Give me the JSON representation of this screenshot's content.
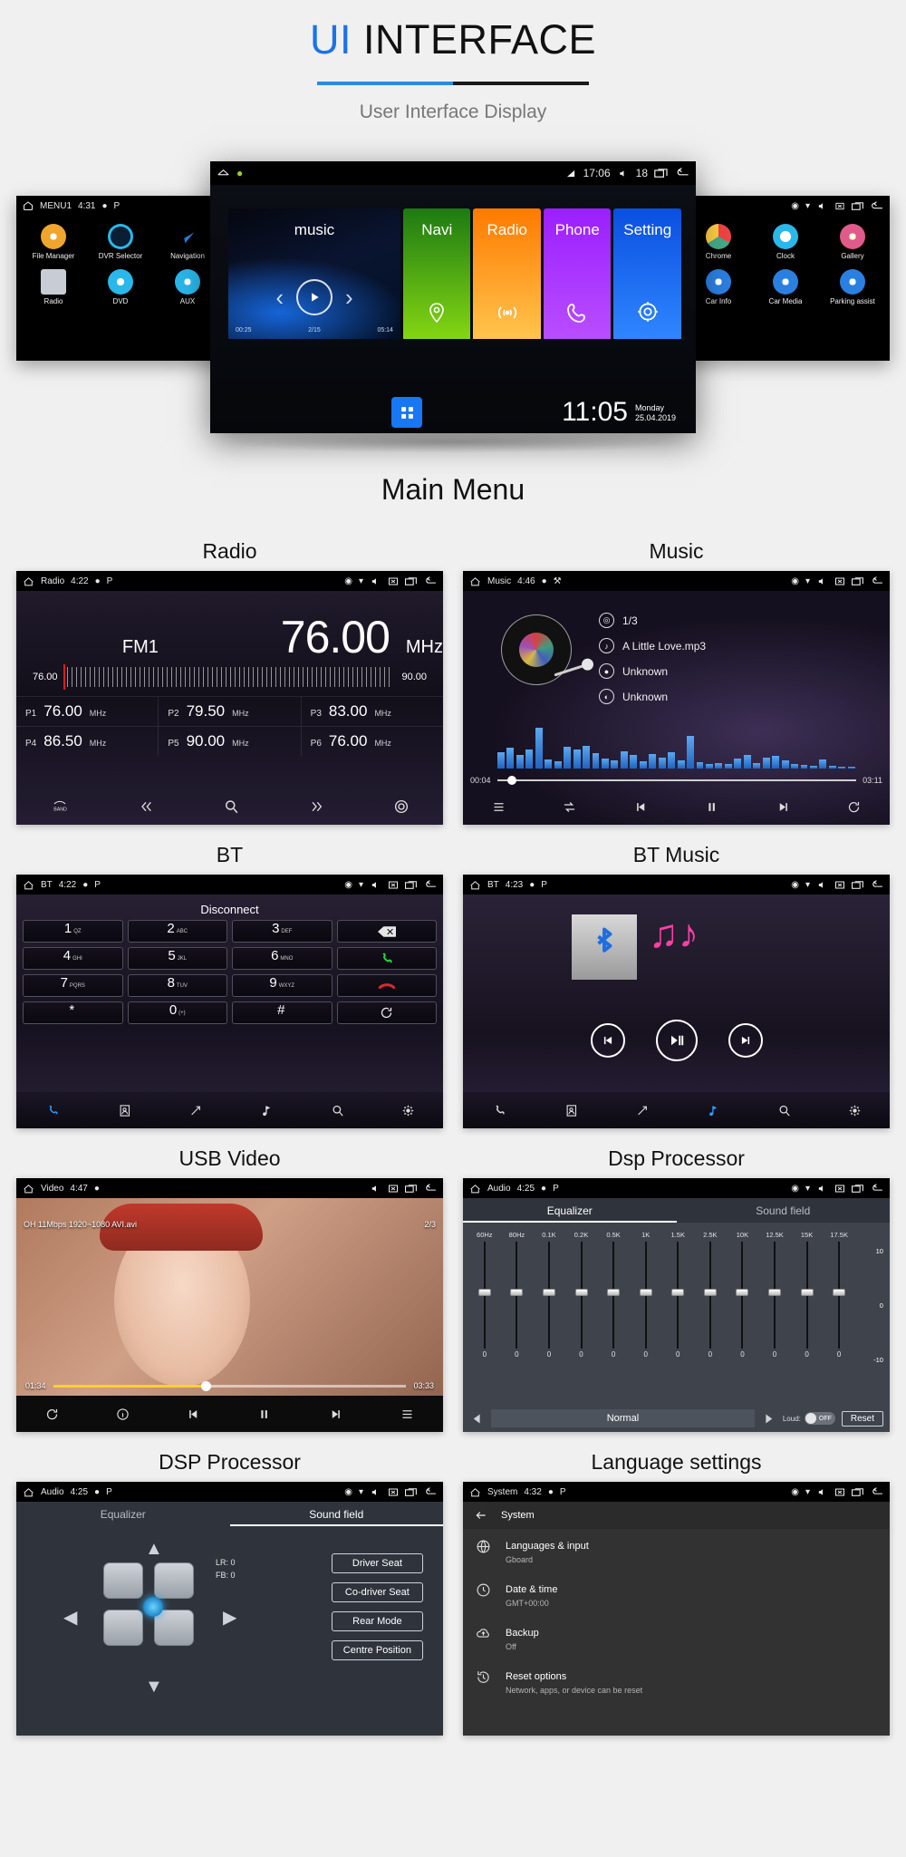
{
  "header": {
    "title_accent": "UI",
    "title_rest": " INTERFACE",
    "subtitle": "User Interface Display",
    "accent_color": "#1a73e8"
  },
  "hero": {
    "left_device": {
      "status": {
        "title": "MENU1",
        "time": "4:31"
      },
      "apps": [
        {
          "label": "File Manager",
          "icon": "disc-icon",
          "color": "#f0a52e"
        },
        {
          "label": "DVR Selector",
          "icon": "camera-lens-icon",
          "color": "#2ab7ea"
        },
        {
          "label": "Navigation",
          "icon": "navigation-arrow-icon",
          "color": "#2b7fe0"
        },
        {
          "label": "Radio",
          "icon": "radio-icon",
          "color": "#c8ccd4"
        },
        {
          "label": "DVD",
          "icon": "dvd-icon",
          "color": "#2ab7ea"
        },
        {
          "label": "AUX",
          "icon": "aux-icon",
          "color": "#2ab7ea"
        }
      ]
    },
    "center_device": {
      "status": {
        "time": "17:06",
        "volume": "18"
      },
      "tiles": [
        {
          "label": "music",
          "key": "music"
        },
        {
          "label": "Navi",
          "key": "navi"
        },
        {
          "label": "Radio",
          "key": "radio"
        },
        {
          "label": "Phone",
          "key": "phone"
        },
        {
          "label": "Setting",
          "key": "setting"
        }
      ],
      "music_time_elapsed": "00:25",
      "music_track": "2/15",
      "music_time_total": "05:14",
      "clock": "11:05",
      "day": "Monday",
      "date": "25.04.2019"
    },
    "right_device": {
      "apps": [
        {
          "label": "Chrome",
          "icon": "chrome-icon",
          "color": "#e44"
        },
        {
          "label": "Clock",
          "icon": "clock-icon",
          "color": "#2ab7ea"
        },
        {
          "label": "Gallery",
          "icon": "gallery-icon",
          "color": "#e05a8a"
        },
        {
          "label": "Car Info",
          "icon": "car-info-icon",
          "color": "#2b7fe0"
        },
        {
          "label": "Car Media",
          "icon": "car-media-icon",
          "color": "#2b7fe0"
        },
        {
          "label": "Parking assist",
          "icon": "parking-assist-icon",
          "color": "#2b7fe0"
        }
      ]
    }
  },
  "main_menu_title": "Main Menu",
  "panels": {
    "radio": {
      "caption": "Radio",
      "status": {
        "title": "Radio",
        "time": "4:22"
      },
      "band": "FM1",
      "frequency": "76.00",
      "unit": "MHz",
      "scale_min": "76.00",
      "scale_max": "90.00",
      "presets": [
        {
          "slot": "P1",
          "value": "76.00",
          "unit": "MHz"
        },
        {
          "slot": "P2",
          "value": "79.50",
          "unit": "MHz"
        },
        {
          "slot": "P3",
          "value": "83.00",
          "unit": "MHz"
        },
        {
          "slot": "P4",
          "value": "86.50",
          "unit": "MHz"
        },
        {
          "slot": "P5",
          "value": "90.00",
          "unit": "MHz"
        },
        {
          "slot": "P6",
          "value": "76.00",
          "unit": "MHz"
        }
      ],
      "toolbar": [
        "band-button",
        "prev-button",
        "scan-button",
        "next-button",
        "settings-button"
      ]
    },
    "music": {
      "caption": "Music",
      "status": {
        "title": "Music",
        "time": "4:46"
      },
      "track_index": "1/3",
      "track_title": "A Little Love.mp3",
      "artist": "Unknown",
      "album": "Unknown",
      "elapsed": "00:04",
      "total": "03:11",
      "toolbar": [
        "playlist-button",
        "shuffle-button",
        "previous-button",
        "pause-button",
        "next-button",
        "repeat-button"
      ]
    },
    "bt": {
      "caption": "BT",
      "status": {
        "title": "BT",
        "time": "4:22"
      },
      "connection_status": "Disconnect",
      "keys": [
        {
          "digit": "1",
          "sub": "QZ"
        },
        {
          "digit": "2",
          "sub": "ABC"
        },
        {
          "digit": "3",
          "sub": "DEF"
        },
        {
          "digit": "",
          "sub": "",
          "icon": "backspace-icon"
        },
        {
          "digit": "4",
          "sub": "GHI"
        },
        {
          "digit": "5",
          "sub": "JKL"
        },
        {
          "digit": "6",
          "sub": "MNO"
        },
        {
          "digit": "",
          "sub": "",
          "icon": "call-answer-icon"
        },
        {
          "digit": "7",
          "sub": "PQRS"
        },
        {
          "digit": "8",
          "sub": "TUV"
        },
        {
          "digit": "9",
          "sub": "WXYZ"
        },
        {
          "digit": "",
          "sub": "",
          "icon": "call-end-icon"
        },
        {
          "digit": "*",
          "sub": ""
        },
        {
          "digit": "0",
          "sub": "(+)"
        },
        {
          "digit": "#",
          "sub": ""
        },
        {
          "digit": "",
          "sub": "",
          "icon": "sync-icon"
        }
      ],
      "toolbar": [
        "dialpad-button",
        "contacts-button",
        "call-log-button",
        "bt-music-button",
        "search-button",
        "settings-button"
      ]
    },
    "btmusic": {
      "caption": "BT Music",
      "status": {
        "title": "BT",
        "time": "4:23"
      },
      "toolbar": [
        "dialpad-button",
        "contacts-button",
        "call-log-button",
        "bt-music-button",
        "search-button",
        "settings-button"
      ]
    },
    "usbvideo": {
      "caption": "USB Video",
      "status": {
        "title": "Video",
        "time": "4:47"
      },
      "file_info": "OH 11Mbps 1920~1080 AVI.avi",
      "index": "2/3",
      "elapsed": "01:34",
      "total": "03:33",
      "toolbar": [
        "repeat-button",
        "info-button",
        "previous-button",
        "pause-button",
        "next-button",
        "playlist-button"
      ]
    },
    "dsp": {
      "caption": "Dsp Processor",
      "status": {
        "title": "Audio",
        "time": "4:25"
      },
      "tabs": [
        {
          "label": "Equalizer",
          "selected": true
        },
        {
          "label": "Sound field",
          "selected": false
        }
      ],
      "bands": [
        "60Hz",
        "80Hz",
        "0.1K",
        "0.2K",
        "0.5K",
        "1K",
        "1.5K",
        "2.5K",
        "10K",
        "12.5K",
        "15K",
        "17.5K"
      ],
      "values": [
        "0",
        "0",
        "0",
        "0",
        "0",
        "0",
        "0",
        "0",
        "0",
        "0",
        "0",
        "0"
      ],
      "ruler": [
        "10",
        "0",
        "-10"
      ],
      "preset": "Normal",
      "loud_label": "Loud:",
      "loud_state": "OFF",
      "reset_label": "Reset"
    },
    "dsp2": {
      "caption": "DSP Processor",
      "status": {
        "title": "Audio",
        "time": "4:25"
      },
      "tabs": [
        {
          "label": "Equalizer",
          "selected": false
        },
        {
          "label": "Sound field",
          "selected": true
        }
      ],
      "lr": "LR: 0",
      "fb": "FB: 0",
      "buttons": [
        "Driver Seat",
        "Co-driver Seat",
        "Rear Mode",
        "Centre Position"
      ]
    },
    "language": {
      "caption": "Language settings",
      "status": {
        "title": "System",
        "time": "4:32"
      },
      "breadcrumb": "System",
      "items": [
        {
          "title": "Languages & input",
          "sub": "Gboard",
          "icon": "globe-icon"
        },
        {
          "title": "Date & time",
          "sub": "GMT+00:00",
          "icon": "clock-icon"
        },
        {
          "title": "Backup",
          "sub": "Off",
          "icon": "cloud-upload-icon"
        },
        {
          "title": "Reset options",
          "sub": "Network, apps, or device can be reset",
          "icon": "history-icon"
        }
      ]
    }
  }
}
